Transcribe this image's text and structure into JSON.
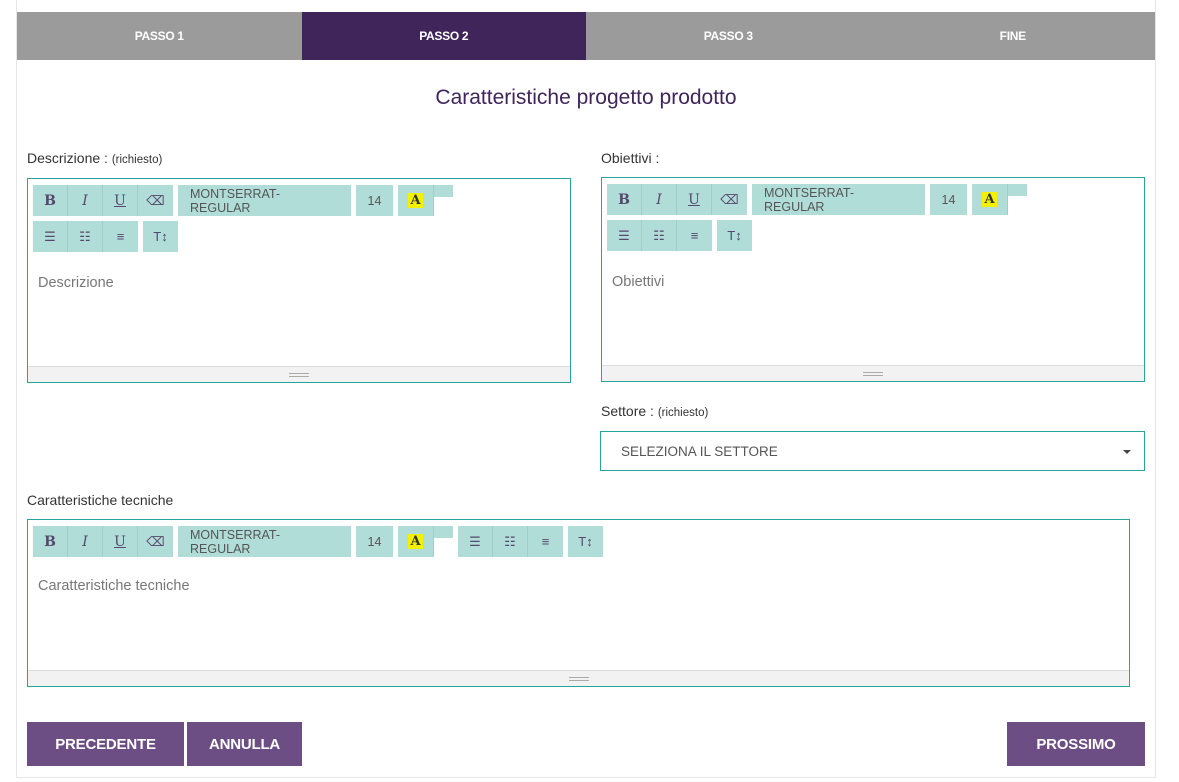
{
  "steps": [
    {
      "label": "PASSO 1",
      "active": false
    },
    {
      "label": "PASSO 2",
      "active": true
    },
    {
      "label": "PASSO 3",
      "active": false
    },
    {
      "label": "FINE",
      "active": false
    }
  ],
  "title": "Caratteristiche progetto prodotto",
  "descrizione": {
    "label": "Descrizione :",
    "required": "(richiesto)",
    "placeholder": "Descrizione"
  },
  "obiettivi": {
    "label": "Obiettivi :",
    "placeholder": "Obiettivi"
  },
  "settore": {
    "label": "Settore :",
    "required": "(richiesto)",
    "selected": "SELEZIONA IL SETTORE"
  },
  "tecniche": {
    "label": "Caratteristiche tecniche",
    "placeholder": "Caratteristiche tecniche"
  },
  "toolbar": {
    "bold": "B",
    "italic": "I",
    "underline": "U",
    "font": "MONTSERRAT-REGULAR",
    "size": "14",
    "color": "A",
    "height": "T↕",
    "icons": [
      "bold-icon",
      "italic-icon",
      "underline-icon",
      "eraser-icon",
      "font-color-icon",
      "unordered-list-icon",
      "ordered-list-icon",
      "align-icon",
      "line-height-icon"
    ]
  },
  "buttons": {
    "previous": "PRECEDENTE",
    "cancel": "ANNULLA",
    "next": "PROSSIMO"
  },
  "colors": {
    "primary": "#40255b",
    "button": "#6c4e84",
    "border": "#2aa39d",
    "toolbar": "#b1ddd8",
    "step_inactive": "#9b9b9b"
  }
}
